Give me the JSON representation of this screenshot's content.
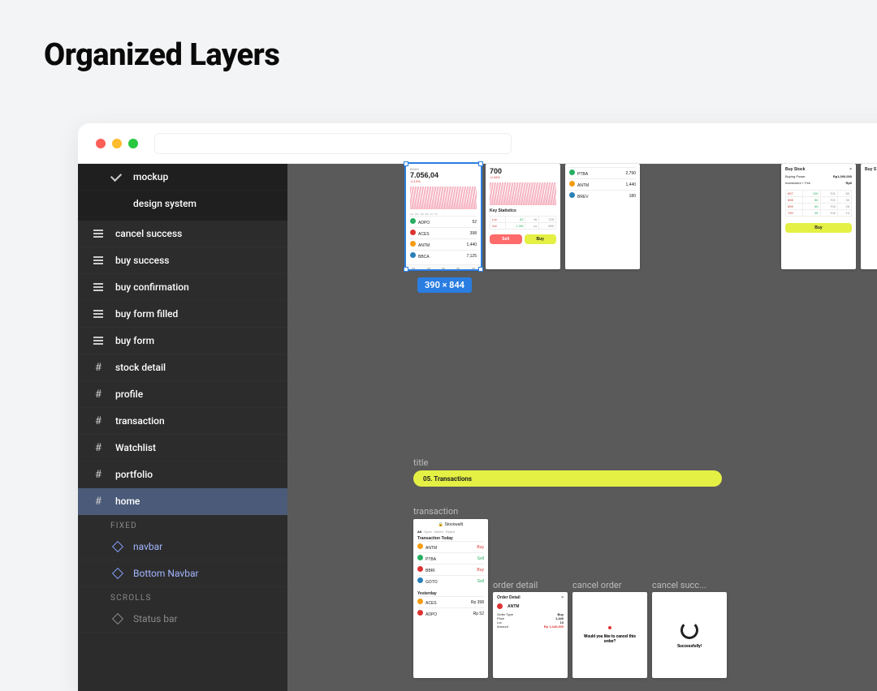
{
  "page_title": "Organized Layers",
  "window": {
    "traffic_lights": [
      "close",
      "minimize",
      "zoom"
    ]
  },
  "pages": [
    {
      "label": "mockup",
      "checked": true
    },
    {
      "label": "design system",
      "checked": false
    }
  ],
  "layers": [
    {
      "type": "layer",
      "label": "cancel success"
    },
    {
      "type": "layer",
      "label": "buy success"
    },
    {
      "type": "layer",
      "label": "buy confirmation"
    },
    {
      "type": "layer",
      "label": "buy form filled"
    },
    {
      "type": "layer",
      "label": "buy form"
    },
    {
      "type": "frame",
      "label": "stock detail"
    },
    {
      "type": "frame",
      "label": "profile"
    },
    {
      "type": "frame",
      "label": "transaction"
    },
    {
      "type": "frame",
      "label": "Watchlist"
    },
    {
      "type": "frame",
      "label": "portfolio"
    },
    {
      "type": "frame",
      "label": "home",
      "selected": true
    }
  ],
  "section_fixed": "FIXED",
  "children_fixed": [
    {
      "type": "component",
      "label": "navbar"
    },
    {
      "type": "component",
      "label": "Bottom Navbar"
    }
  ],
  "section_scrolls": "SCROLLS",
  "children_scrolls": [
    {
      "type": "component_muted",
      "label": "Status bar"
    }
  ],
  "canvas": {
    "selected_frame_size": "390 × 844",
    "labels": {
      "title": "title",
      "transaction": "transaction",
      "order_detail": "order detail",
      "cancel_order": "cancel order",
      "cancel_succ": "cancel succ..."
    },
    "section_pill": "05. Transactions",
    "mock_stock_list": {
      "symbol": "BHAS",
      "price": "7.056,04",
      "change": "-0.13%",
      "tickers": [
        {
          "sym": "ADPO",
          "val": "52"
        },
        {
          "sym": "ACES",
          "val": "398"
        },
        {
          "sym": "ANTM",
          "val": "1,440"
        },
        {
          "sym": "BBCA",
          "val": "7,125"
        }
      ]
    },
    "mock_stock_detail": {
      "price": "700",
      "stats_title": "Key Statistics",
      "btn_sell": "Sell",
      "btn_buy": "Buy"
    },
    "mock_watchlist": {
      "tickers": [
        {
          "sym": "PTBA",
          "val": "2,790"
        },
        {
          "sym": "ANTM",
          "val": "1,440"
        },
        {
          "sym": "BREV",
          "val": "180"
        }
      ]
    },
    "mock_buy_stock": {
      "title": "Buy Stock",
      "buying_power": "Buying Power",
      "amount": "Rp1,000,000",
      "btn": "Buy"
    },
    "mock_transaction": {
      "brand": "Stockwallt",
      "today": "Transaction Today",
      "yesterday": "Yesterday"
    },
    "mock_order_detail": {
      "title": "Order Detail",
      "symbol": "ANTM"
    },
    "mock_cancel_order": {
      "msg": "Would you like to cancel this order?"
    },
    "mock_cancel_success": {
      "msg": "Successfully!"
    }
  }
}
